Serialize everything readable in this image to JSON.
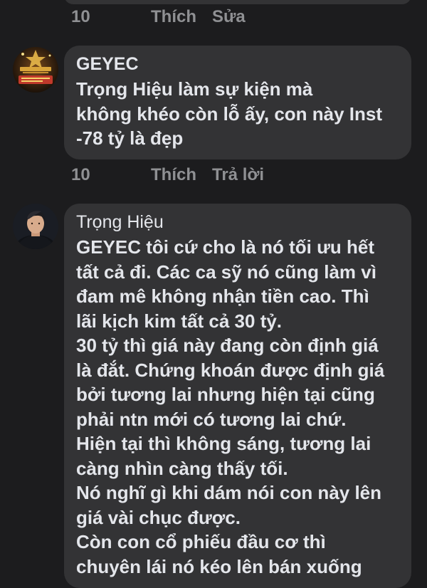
{
  "comment_prev": {
    "like_count": "10",
    "like_label": "Thích",
    "action_label": "Sửa"
  },
  "comment_geyec": {
    "author": "GEYEC",
    "avatar_alt": "GEYEC avatar",
    "text_lines": [
      "Trọng Hiệu   làm sự kiện mà",
      "không khéo còn lỗ ấy, con này Inst",
      "-78 tỷ là đẹp"
    ],
    "like_count": "10",
    "like_label": "Thích",
    "action_label": "Trả lời"
  },
  "comment_tronghieu": {
    "author": "Trọng Hiệu",
    "text_lines": [
      "GEYEC  tôi cứ cho là nó tối ưu hết",
      "tất cả đi. Các ca sỹ nó cũng làm vì",
      "đam mê không nhận tiền cao. Thì",
      "lãi kịch kim tất cả 30 tỷ.",
      "30 tỷ thì giá này đang còn định giá",
      "là đắt. Chứng khoán được định giá",
      "bởi tương lai nhưng hiện tại cũng",
      "phải ntn mới có tương lai chứ.",
      "Hiện tại thì không sáng, tương lai",
      "càng nhìn càng thấy tối.",
      "Nó nghĩ gì khi dám nói con này lên",
      "giá vài chục được.",
      "Còn con cổ phiếu đầu cơ thì",
      "chuyên lái nó kéo lên bán xuống"
    ]
  },
  "colors": {
    "background": "#1c1c1e",
    "bubble": "#333335",
    "text": "#e4e6eb",
    "muted": "#8f9093"
  }
}
